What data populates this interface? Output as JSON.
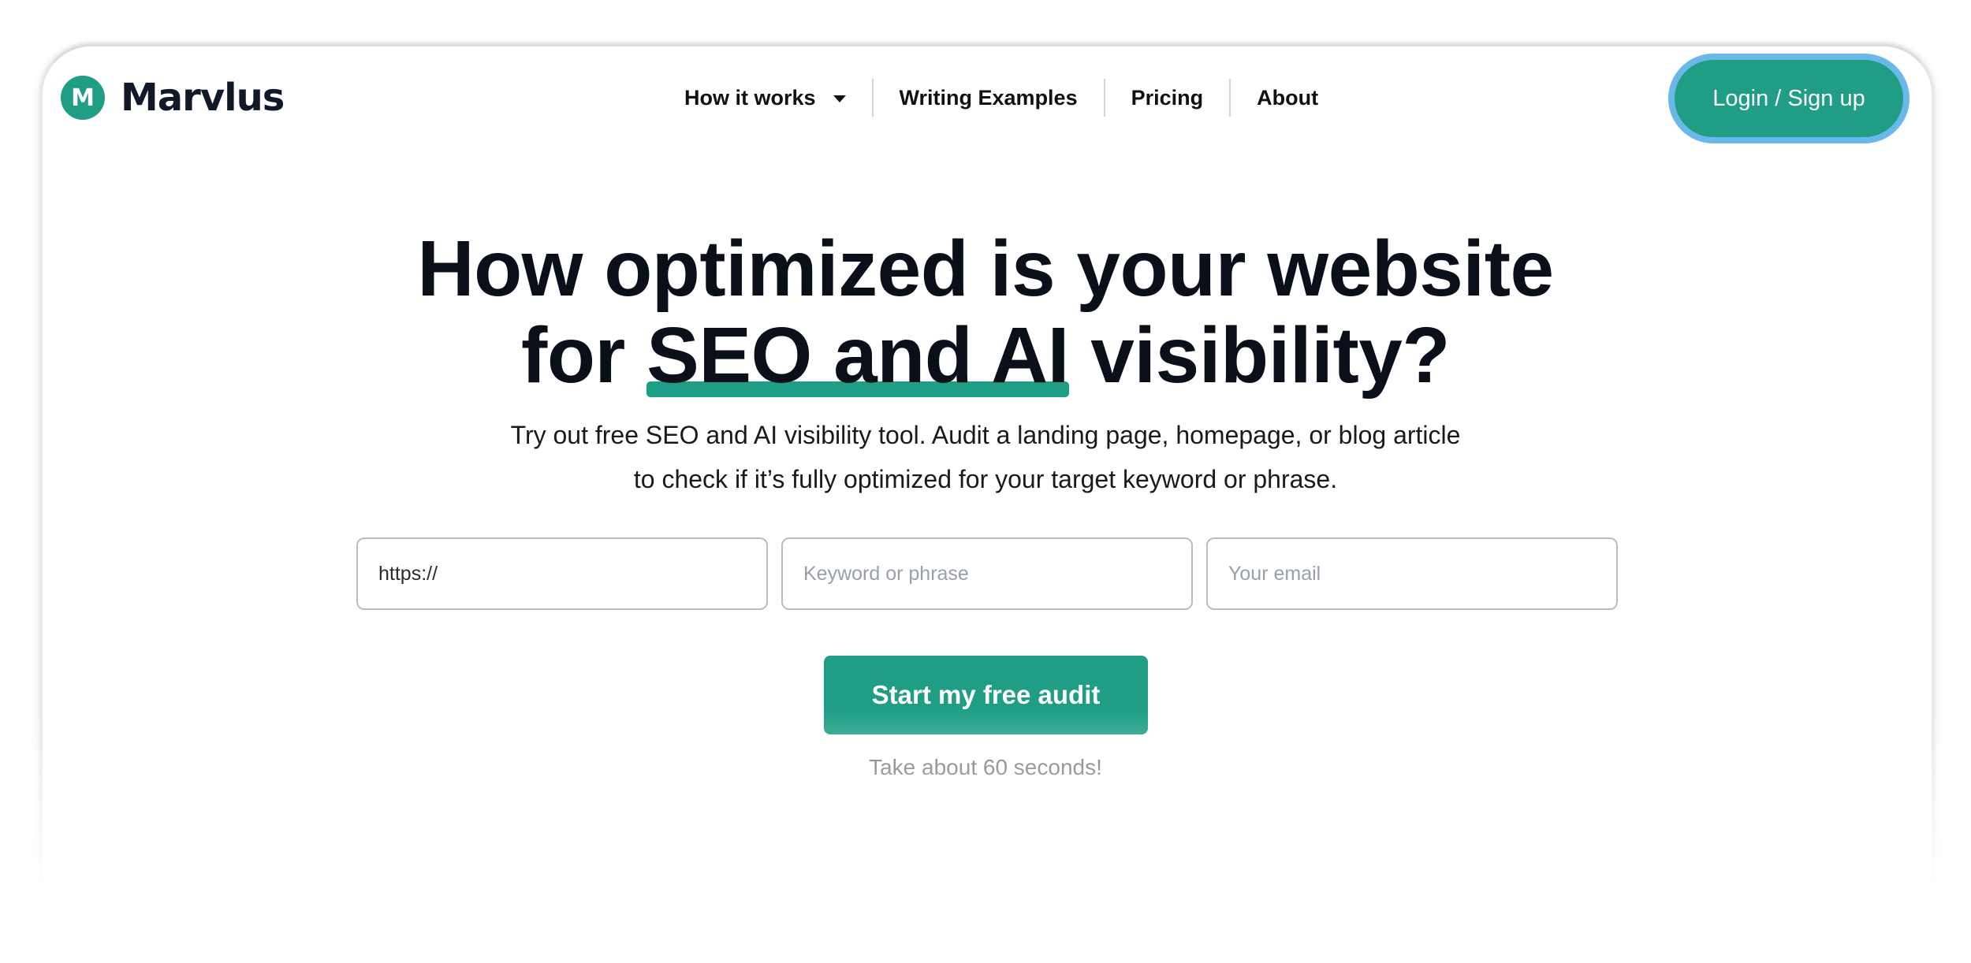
{
  "brand": {
    "name": "Marvlus",
    "mark_letter": "M",
    "accent": "#1f9e85",
    "focus_ring": "#6ab8ea"
  },
  "nav": {
    "items": [
      {
        "label": "How it works",
        "has_dropdown": true,
        "icon": "caret-down-icon"
      },
      {
        "label": "Writing Examples"
      },
      {
        "label": "Pricing"
      },
      {
        "label": "About"
      }
    ],
    "login_label": "Login / Sign up"
  },
  "hero": {
    "title_line1": "How optimized is your website",
    "title_line2_pre": "for ",
    "title_line2_highlight": "SEO and AI",
    "title_line2_post": " visibility?",
    "subtitle_line1": "Try out free SEO and AI visibility tool. Audit a landing page, homepage, or blog article",
    "subtitle_line2": "to check if it’s fully optimized for your target keyword or phrase."
  },
  "form": {
    "url_value": "https://",
    "keyword_placeholder": "Keyword or phrase",
    "email_placeholder": "Your email",
    "submit_label": "Start my free audit",
    "note": "Take about 60 seconds!"
  }
}
